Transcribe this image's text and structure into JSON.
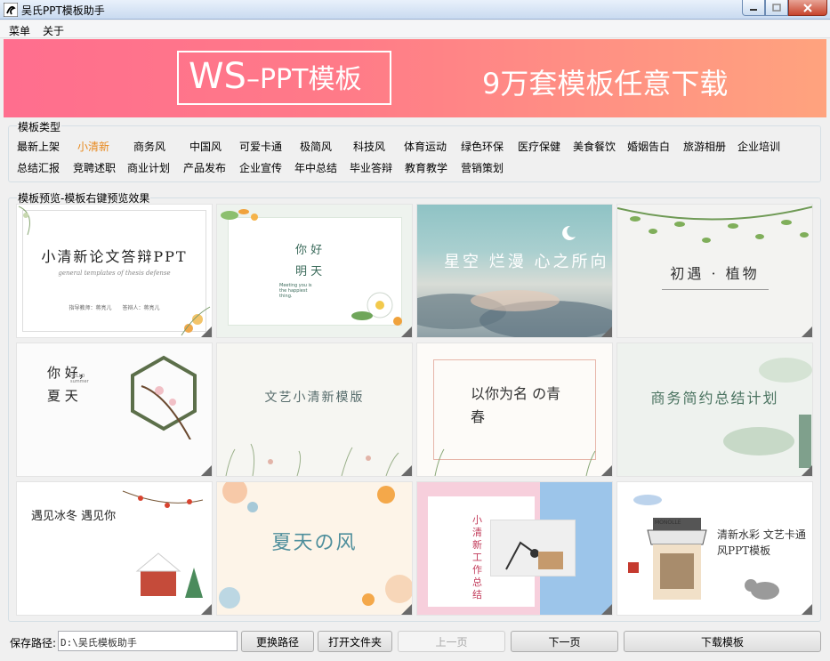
{
  "window": {
    "title": "吴氏PPT模板助手"
  },
  "menu": {
    "items": [
      "菜单",
      "关于"
    ]
  },
  "banner": {
    "brand": "WS",
    "brand_suffix": "PPT模板",
    "slogan": "9万套模板任意下载"
  },
  "categories": {
    "legend": "模板类型",
    "active": "小清新",
    "row1": [
      "最新上架",
      "小清新",
      "商务风",
      "中国风",
      "可爱卡通",
      "极简风",
      "科技风",
      "体育运动",
      "绿色环保",
      "医疗保健",
      "美食餐饮",
      "婚姻告白",
      "旅游相册",
      "企业培训"
    ],
    "row2": [
      "总结汇报",
      "竞聘述职",
      "商业计划",
      "产品发布",
      "企业宣传",
      "年中总结",
      "毕业答辩",
      "教育教学",
      "营销策划"
    ]
  },
  "preview": {
    "legend": "模板预览-模板右键预览效果",
    "thumbs": [
      {
        "title": "小清新论文答辩PPT",
        "sub": "general templates of thesis defense",
        "extra": "指导教师：蒋亮儿　　答辩人：蒋亮儿"
      },
      {
        "title": "你 好 明 天",
        "sub": "Meeting you is the happiest thing."
      },
      {
        "title": "星空 烂漫 心之所向"
      },
      {
        "title": "初遇 · 植物"
      },
      {
        "title": "你 好，夏 天",
        "sub": "HELLO summer"
      },
      {
        "title": "文艺小清新模版"
      },
      {
        "title": "以你为名 の青春"
      },
      {
        "title": "商务简约总结计划"
      },
      {
        "title": "遇见冰冬 遇见你"
      },
      {
        "title": "夏天の风"
      },
      {
        "title": "小清新 工作总结"
      },
      {
        "title": "清新水彩 文艺卡通风PPT模板",
        "sub": "MONOLLE"
      }
    ]
  },
  "bottom": {
    "path_label": "保存路径:",
    "path_value": "D:\\吴氏模板助手",
    "change_path": "更换路径",
    "open_folder": "打开文件夹",
    "prev_page": "上一页",
    "next_page": "下一页",
    "download": "下载模板"
  },
  "colors": {
    "banner_start": "#ff6e8e",
    "banner_end": "#ffa37e",
    "active_category": "#e8881c"
  }
}
